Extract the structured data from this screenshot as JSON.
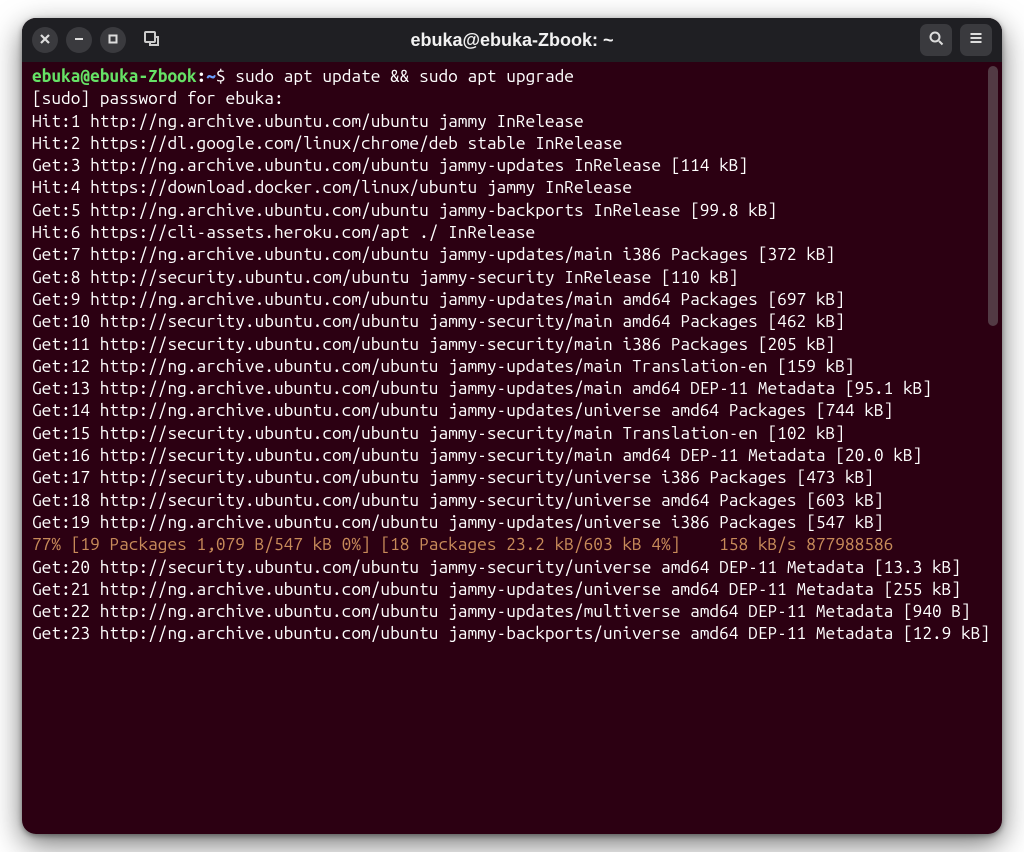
{
  "window": {
    "title": "ebuka@ebuka-Zbook: ~"
  },
  "prompt": {
    "user_host": "ebuka@ebuka-Zbook",
    "path": "~",
    "command": "sudo apt update && sudo apt upgrade"
  },
  "output_lines": [
    "[sudo] password for ebuka:",
    "Hit:1 http://ng.archive.ubuntu.com/ubuntu jammy InRelease",
    "Hit:2 https://dl.google.com/linux/chrome/deb stable InRelease",
    "Get:3 http://ng.archive.ubuntu.com/ubuntu jammy-updates InRelease [114 kB]",
    "Hit:4 https://download.docker.com/linux/ubuntu jammy InRelease",
    "Get:5 http://ng.archive.ubuntu.com/ubuntu jammy-backports InRelease [99.8 kB]",
    "Hit:6 https://cli-assets.heroku.com/apt ./ InRelease",
    "Get:7 http://ng.archive.ubuntu.com/ubuntu jammy-updates/main i386 Packages [372 kB]",
    "Get:8 http://security.ubuntu.com/ubuntu jammy-security InRelease [110 kB]",
    "Get:9 http://ng.archive.ubuntu.com/ubuntu jammy-updates/main amd64 Packages [697 kB]",
    "Get:10 http://security.ubuntu.com/ubuntu jammy-security/main amd64 Packages [462 kB]",
    "Get:11 http://security.ubuntu.com/ubuntu jammy-security/main i386 Packages [205 kB]",
    "Get:12 http://ng.archive.ubuntu.com/ubuntu jammy-updates/main Translation-en [159 kB]",
    "Get:13 http://ng.archive.ubuntu.com/ubuntu jammy-updates/main amd64 DEP-11 Metadata [95.1 kB]",
    "Get:14 http://ng.archive.ubuntu.com/ubuntu jammy-updates/universe amd64 Packages [744 kB]",
    "Get:15 http://security.ubuntu.com/ubuntu jammy-security/main Translation-en [102 kB]",
    "Get:16 http://security.ubuntu.com/ubuntu jammy-security/main amd64 DEP-11 Metadata [20.0 kB]",
    "Get:17 http://security.ubuntu.com/ubuntu jammy-security/universe i386 Packages [473 kB]",
    "Get:18 http://security.ubuntu.com/ubuntu jammy-security/universe amd64 Packages [603 kB]",
    "Get:19 http://ng.archive.ubuntu.com/ubuntu jammy-updates/universe i386 Packages [547 kB]"
  ],
  "progress_line": "77% [19 Packages 1,079 B/547 kB 0%] [18 Packages 23.2 kB/603 kB 4%]    158 kB/s 877988586",
  "output_lines_after": [
    "Get:20 http://security.ubuntu.com/ubuntu jammy-security/universe amd64 DEP-11 Metadata [13.3 kB]",
    "Get:21 http://ng.archive.ubuntu.com/ubuntu jammy-updates/universe amd64 DEP-11 Metadata [255 kB]",
    "Get:22 http://ng.archive.ubuntu.com/ubuntu jammy-updates/multiverse amd64 DEP-11 Metadata [940 B]",
    "Get:23 http://ng.archive.ubuntu.com/ubuntu jammy-backports/universe amd64 DEP-11 Metadata [12.9 kB]"
  ],
  "colors": {
    "terminal_bg": "#2c0012",
    "titlebar_bg": "#1f1f23",
    "prompt_user": "#66e266",
    "prompt_path": "#6aa0ff",
    "progress": "#c88b5a"
  }
}
